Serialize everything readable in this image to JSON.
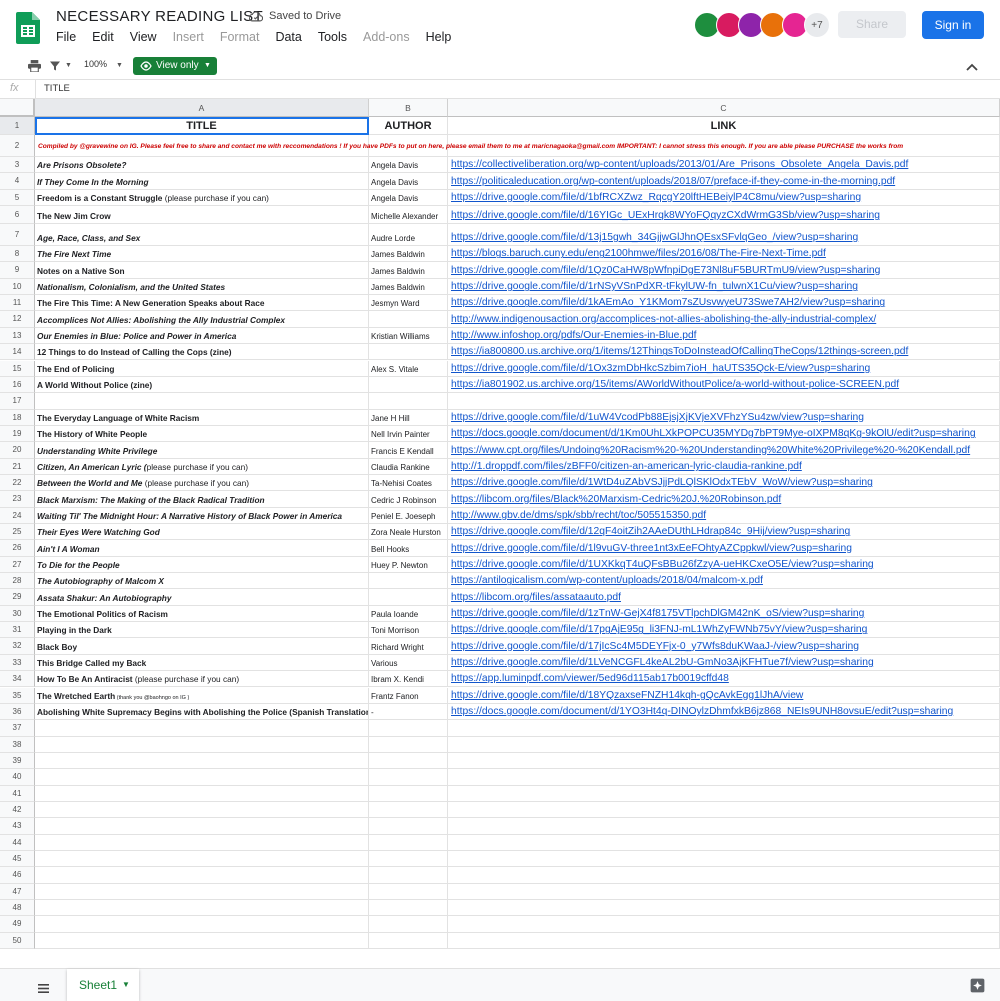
{
  "header": {
    "title": "NECESSARY READING LIST",
    "saved_status": "Saved to Drive",
    "menu": [
      {
        "label": "File",
        "disabled": false
      },
      {
        "label": "Edit",
        "disabled": false
      },
      {
        "label": "View",
        "disabled": false
      },
      {
        "label": "Insert",
        "disabled": true
      },
      {
        "label": "Format",
        "disabled": true
      },
      {
        "label": "Data",
        "disabled": false
      },
      {
        "label": "Tools",
        "disabled": false
      },
      {
        "label": "Add-ons",
        "disabled": true
      },
      {
        "label": "Help",
        "disabled": false
      }
    ],
    "avatars": [
      {
        "icon": "avatar-green-icon",
        "color": "#1e8e3e"
      },
      {
        "icon": "avatar-pink-icon",
        "color": "#d81b60"
      },
      {
        "icon": "avatar-purple-icon",
        "color": "#8e24aa"
      },
      {
        "icon": "avatar-orange-icon",
        "color": "#e8710a"
      },
      {
        "icon": "avatar-red-icon",
        "color": "#e52592"
      }
    ],
    "avatars_more": "+7",
    "share_label": "Share",
    "signin_label": "Sign in"
  },
  "toolbar": {
    "zoom": "100%",
    "view_mode": "View only"
  },
  "formula_bar": {
    "fx_icon": "fx",
    "content": "TITLE"
  },
  "grid": {
    "columns": [
      "A",
      "B",
      "C"
    ],
    "headers": {
      "title": "TITLE",
      "author": "AUTHOR",
      "link": "LINK"
    },
    "note": "Compiled by @gravewine on IG. Please feel free to share and contact me with reccomendations ! If you have PDFs to put on here, please email them to me at maricnagaoka@gmail.com IMPORTANT: I cannot stress this enough. If you are able please PURCHASE the works from",
    "rows": [
      {
        "n": 3,
        "title": "Are Prisons Obsolete?",
        "italic": true,
        "author": "Angela Davis",
        "link": "https://collectiveliberation.org/wp-content/uploads/2013/01/Are_Prisons_Obsolete_Angela_Davis.pdf"
      },
      {
        "n": 4,
        "title": "If They Come In the Morning",
        "italic": true,
        "author": "Angela Davis",
        "link": "https://politicaleducation.org/wp-content/uploads/2018/07/preface-if-they-come-in-the-morning.pdf"
      },
      {
        "n": 5,
        "title": "Freedom is a Constant Struggle",
        "note": "  (please purchase if you can)",
        "italic": false,
        "author": "Angela Davis",
        "link": "https://drive.google.com/file/d/1bfRCXZwz_RqcgY20lftHEBeiylP4C8mu/view?usp=sharing"
      },
      {
        "n": 6,
        "title": "The New Jim Crow",
        "italic": false,
        "author": "Michelle Alexander",
        "link": "https://drive.google.com/file/d/16YIGc_UExHrqk8WYoFQqyzCXdWrmG3Sb/view?usp=sharing"
      },
      {
        "n": 7,
        "title": "Age, Race, Class, and Sex",
        "italic": true,
        "author": "Audre Lorde",
        "link": "https://drive.google.com/file/d/13j15gwh_34GjjwGlJhnQEsxSFvlqGeo_/view?usp=sharing"
      },
      {
        "n": 8,
        "title": "The Fire Next Time",
        "italic": true,
        "author": "James Baldwin",
        "link": "https://blogs.baruch.cuny.edu/eng2100hmwe/files/2016/08/The-Fire-Next-Time.pdf"
      },
      {
        "n": 9,
        "title": "Notes on a Native Son",
        "italic": false,
        "author": "James Baldwin",
        "link": "https://drive.google.com/file/d/1Qz0CaHW8pWfnpiDgE73Nl8uF5BURTmU9/view?usp=sharing"
      },
      {
        "n": 10,
        "title": "Nationalism, Colonialism, and the United States",
        "italic": true,
        "author": "James Baldwin",
        "link": "https://drive.google.com/file/d/1rNSyVSnPdXR-tFkylUW-fn_tulwnX1Cu/view?usp=sharing"
      },
      {
        "n": 11,
        "title": "The Fire This Time: A New Generation Speaks about Race",
        "italic": false,
        "author": "Jesmyn Ward",
        "link": "https://drive.google.com/file/d/1kAEmAo_Y1KMom7sZUsvwyeU73Swe7AH2/view?usp=sharing"
      },
      {
        "n": 12,
        "title": "Accomplices Not Allies: Abolishing the Ally Industrial Complex",
        "italic": true,
        "author": "",
        "link": "http://www.indigenousaction.org/accomplices-not-allies-abolishing-the-ally-industrial-complex/"
      },
      {
        "n": 13,
        "title": "Our Enemies in Blue: Police and Power in America",
        "italic": true,
        "author": "Kristian Williams",
        "link": "http://www.infoshop.org/pdfs/Our-Enemies-in-Blue.pdf"
      },
      {
        "n": 14,
        "title": "12 Things to do Instead of Calling the Cops (zine)",
        "italic": false,
        "author": "",
        "link": "https://ia800800.us.archive.org/1/items/12ThingsToDoInsteadOfCallingTheCops/12things-screen.pdf"
      },
      {
        "n": 15,
        "title": "The End of Policing",
        "italic": false,
        "author": "Alex S. Vitale",
        "link": "https://drive.google.com/file/d/1Ox3zmDbHkcSzbim7ioH_haUTS35Qck-E/view?usp=sharing"
      },
      {
        "n": 16,
        "title": "A World Without Police (zine)",
        "italic": false,
        "author": "",
        "link": "https://ia801902.us.archive.org/15/items/AWorldWithoutPolice/a-world-without-police-SCREEN.pdf"
      },
      {
        "n": 17,
        "title": "",
        "italic": false,
        "author": "",
        "link": ""
      },
      {
        "n": 18,
        "title": "The Everyday Language of White Racism",
        "italic": false,
        "author": "Jane H Hill",
        "link": "https://drive.google.com/file/d/1uW4VcodPb88EjsjXjKVjeXVFhzYSu4zw/view?usp=sharing"
      },
      {
        "n": 19,
        "title": "The History of White People",
        "italic": false,
        "author": "Nell Irvin Painter",
        "link": "https://docs.google.com/document/d/1Km0UhLXkPOPCU35MYDg7bPT9Mye-oIXPM8qKg-9kOlU/edit?usp=sharing"
      },
      {
        "n": 20,
        "title": "Understanding White Privilege",
        "italic": true,
        "author": "Francis E Kendall",
        "link": "https://www.cpt.org/files/Undoing%20Racism%20-%20Understanding%20White%20Privilege%20-%20Kendall.pdf"
      },
      {
        "n": 21,
        "title": "Citizen, An American Lyric (",
        "note": "please purchase if you can)",
        "italic": true,
        "author": "Claudia Rankine",
        "link": "http://1.droppdf.com/files/zBFF0/citizen-an-american-lyric-claudia-rankine.pdf"
      },
      {
        "n": 22,
        "title": "Between the World and Me",
        "note": " (please purchase if you can)",
        "italic": true,
        "author": "Ta-Nehisi Coates",
        "link": "https://drive.google.com/file/d/1WtD4uZAbVSJjjPdLQlSKlOdxTEbV_WoW/view?usp=sharing"
      },
      {
        "n": 23,
        "title": "Black Marxism: The Making of the Black Radical Tradition",
        "italic": true,
        "author": "Cedric J Robinson",
        "link": "https://libcom.org/files/Black%20Marxism-Cedric%20J.%20Robinson.pdf"
      },
      {
        "n": 24,
        "title": "Waiting Til' The Midnight Hour: A Narrative History of Black Power in America",
        "italic": true,
        "author": "Peniel E. Joeseph",
        "link": "http://www.gbv.de/dms/spk/sbb/recht/toc/505515350.pdf"
      },
      {
        "n": 25,
        "title": "Their Eyes Were Watching God",
        "italic": true,
        "author": "Zora Neale Hurston",
        "link": "https://drive.google.com/file/d/12qF4oitZih2AAeDUthLHdrap84c_9Hij/view?usp=sharing"
      },
      {
        "n": 26,
        "title": "Ain't I A Woman",
        "italic": true,
        "author": "Bell Hooks",
        "link": "https://drive.google.com/file/d/1l9vuGV-three1nt3xEeFOhtyAZCppkwl/view?usp=sharing"
      },
      {
        "n": 27,
        "title": "To Die for the People",
        "italic": true,
        "author": "Huey P. Newton",
        "link": "https://drive.google.com/file/d/1UXKkqT4uQFsBBu26fZzyA-ueHKCxeO5E/view?usp=sharing"
      },
      {
        "n": 28,
        "title": "The Autobiography of Malcom X",
        "italic": true,
        "author": "",
        "link": "https://antilogicalism.com/wp-content/uploads/2018/04/malcom-x.pdf"
      },
      {
        "n": 29,
        "title": "Assata Shakur: An Autobiography",
        "italic": true,
        "author": "",
        "link": "https://libcom.org/files/assataauto.pdf"
      },
      {
        "n": 30,
        "title": "The Emotional Politics of Racism",
        "italic": false,
        "author": "Paula Ioande",
        "link": "https://drive.google.com/file/d/1zTnW-GejX4f8175VTlpchDlGM42nK_oS/view?usp=sharing"
      },
      {
        "n": 31,
        "title": "Playing in the Dark",
        "italic": false,
        "author": "Toni Morrison",
        "link": "https://drive.google.com/file/d/17pgAjE95g_li3FNJ-mL1WhZyFWNb75vY/view?usp=sharing"
      },
      {
        "n": 32,
        "title": "Black Boy",
        "italic": false,
        "author": "Richard Wright",
        "link": "https://drive.google.com/file/d/17jIcSc4M5DEYFjx-0_y7Wfs8duKWaaJ-/view?usp=sharing"
      },
      {
        "n": 33,
        "title": "This Bridge Called my Back",
        "italic": false,
        "author": "Various",
        "link": "https://drive.google.com/file/d/1LVeNCGFL4keAL2bU-GmNo3AjKFHTue7f/view?usp=sharing"
      },
      {
        "n": 34,
        "title": "How To Be An Antiracist",
        "note": " (please purchase if you can)",
        "italic": false,
        "author": "Ibram X. Kendi",
        "link": "https://app.luminpdf.com/viewer/5ed96d115ab17b0019cffd48"
      },
      {
        "n": 35,
        "title": "The Wretched Earth",
        "tiny": " (thank you @baohngo on IG )",
        "italic": false,
        "author": "Frantz Fanon",
        "link": "https://drive.google.com/file/d/18YQzaxseFNZH14kqh-gQcAvkEgg1lJhA/view"
      },
      {
        "n": 36,
        "title": "Abolishing White Supremacy Begins with Abolishing the Police (Spanish Translation)",
        "italic": false,
        "author": "-",
        "link": "https://docs.google.com/document/d/1YO3Ht4q-DINOylzDhmfxkB6jz868_NEIs9UNH8ovsuE/edit?usp=sharing"
      }
    ],
    "empty_rows": [
      37,
      38,
      39,
      40,
      41,
      42,
      43,
      44,
      45,
      46,
      47,
      48,
      49,
      50
    ]
  },
  "bottom": {
    "sheet_tab": "Sheet1"
  }
}
